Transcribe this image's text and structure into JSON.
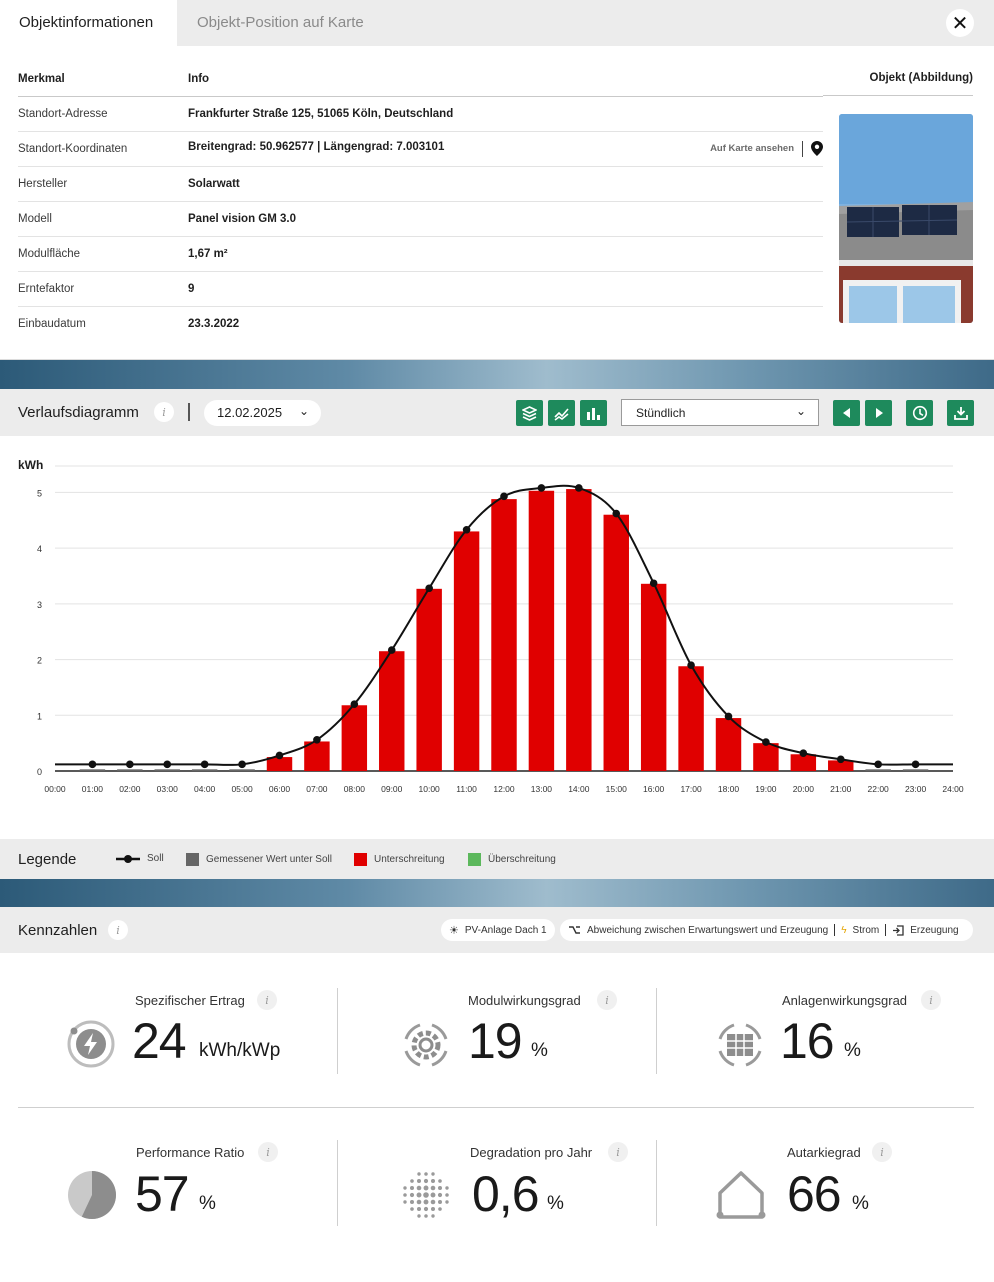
{
  "tabs": [
    {
      "label": "Objektinformationen",
      "active": true
    },
    {
      "label": "Objekt-Position auf Karte",
      "active": false
    }
  ],
  "close_label": "✕",
  "info_table": {
    "headers": {
      "feature": "Merkmal",
      "info": "Info",
      "object": "Objekt (Abbildung)"
    },
    "rows": [
      {
        "feature": "Standort-Adresse",
        "info": "Frankfurter Straße 125, 51065 Köln, Deutschland"
      },
      {
        "feature": "Standort-Koordinaten",
        "info": "Breitengrad: 50.962577 | Längengrad: 7.003101",
        "link": "Auf Karte ansehen"
      },
      {
        "feature": "Hersteller",
        "info": "Solarwatt"
      },
      {
        "feature": "Modell",
        "info": "Panel vision GM 3.0"
      },
      {
        "feature": "Modulfläche",
        "info": "1,67 m²"
      },
      {
        "feature": "Erntefaktor",
        "info": "9"
      },
      {
        "feature": "Einbaudatum",
        "info": "23.3.2022"
      }
    ]
  },
  "chart_panel": {
    "title": "Verlaufsdiagramm",
    "date": "12.02.2025",
    "interval": "Stündlich"
  },
  "chart_data": {
    "type": "bar",
    "ylabel": "kWh",
    "ylim": [
      0,
      5.6
    ],
    "yticks": [
      0,
      1,
      2,
      3,
      4,
      5
    ],
    "xticks": [
      "00:00",
      "01:00",
      "02:00",
      "03:00",
      "04:00",
      "05:00",
      "06:00",
      "07:00",
      "08:00",
      "09:00",
      "10:00",
      "11:00",
      "12:00",
      "13:00",
      "14:00",
      "15:00",
      "16:00",
      "17:00",
      "18:00",
      "19:00",
      "20:00",
      "21:00",
      "22:00",
      "23:00",
      "24:00"
    ],
    "categories": [
      "01:00",
      "02:00",
      "03:00",
      "04:00",
      "05:00",
      "06:00",
      "07:00",
      "08:00",
      "09:00",
      "10:00",
      "11:00",
      "12:00",
      "13:00",
      "14:00",
      "15:00",
      "16:00",
      "17:00",
      "18:00",
      "19:00",
      "20:00",
      "21:00",
      "22:00",
      "23:00"
    ],
    "series": [
      {
        "name": "Soll",
        "kind": "line",
        "values": [
          0.12,
          0.12,
          0.12,
          0.12,
          0.12,
          0.28,
          0.56,
          1.2,
          2.17,
          3.28,
          4.33,
          4.93,
          5.08,
          5.08,
          4.62,
          3.37,
          1.9,
          0.98,
          0.52,
          0.32,
          0.21,
          0.12,
          0.12
        ]
      },
      {
        "name": "Unterschreitung",
        "kind": "bar",
        "values": [
          0.03,
          0.03,
          0.03,
          0.03,
          0.03,
          0.25,
          0.53,
          1.18,
          2.15,
          3.27,
          4.3,
          4.88,
          5.03,
          5.06,
          4.6,
          3.36,
          1.88,
          0.95,
          0.5,
          0.3,
          0.19,
          0.03,
          0.03
        ]
      }
    ],
    "colors": {
      "bar": "#e00000",
      "line": "#111111",
      "gray": "#666666",
      "green": "#5cb85c"
    }
  },
  "legend": {
    "title": "Legende",
    "items": [
      {
        "label": "Soll"
      },
      {
        "label": "Gemessener Wert unter Soll"
      },
      {
        "label": "Unterschreitung"
      },
      {
        "label": "Überschreitung"
      }
    ]
  },
  "kpi_panel": {
    "title": "Kennzahlen",
    "filter_plant": "PV-Anlage Dach 1",
    "filter_deviation": "Abweichung zwischen Erwartungswert und Erzeugung",
    "filter_power": "Strom",
    "filter_generation": "Erzeugung",
    "items": [
      {
        "label": "Spezifischer Ertrag",
        "value": "24",
        "unit": "kWh/kWp"
      },
      {
        "label": "Modulwirkungsgrad",
        "value": "19",
        "unit": "%"
      },
      {
        "label": "Anlagenwirkungsgrad",
        "value": "16",
        "unit": "%"
      },
      {
        "label": "Performance Ratio",
        "value": "57",
        "unit": "%",
        "fraction": 0.57
      },
      {
        "label": "Degradation pro Jahr",
        "value": "0,6",
        "unit": "%"
      },
      {
        "label": "Autarkiegrad",
        "value": "66",
        "unit": "%"
      }
    ]
  }
}
